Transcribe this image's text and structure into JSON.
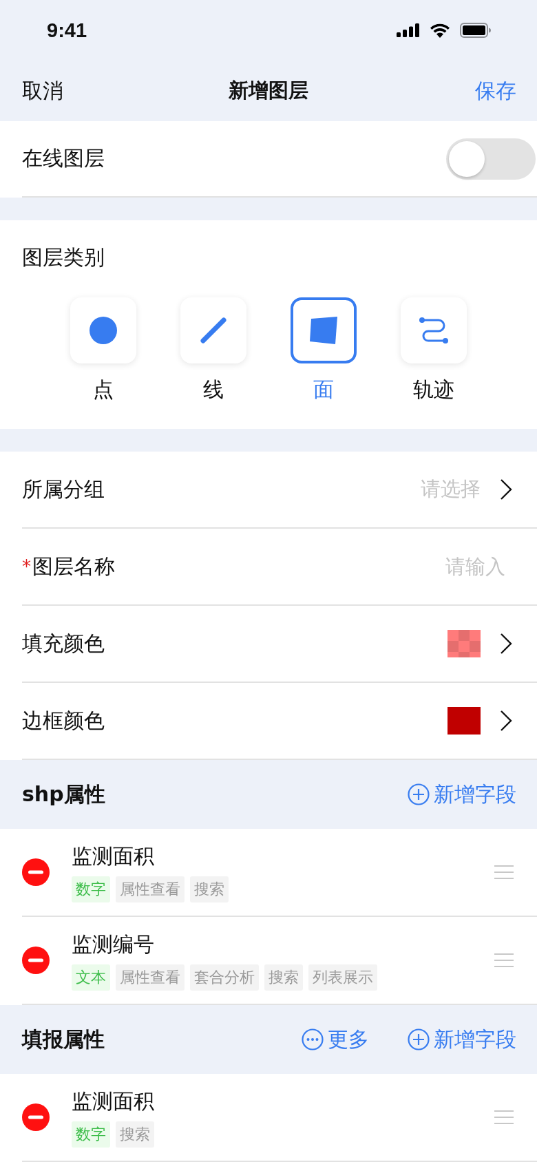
{
  "status_bar": {
    "time": "9:41"
  },
  "nav": {
    "cancel": "取消",
    "title": "新增图层",
    "save": "保存"
  },
  "online_layer": {
    "label": "在线图层",
    "on": false
  },
  "layer_type": {
    "label": "图层类别",
    "options": [
      {
        "kind": "point",
        "label": "点",
        "selected": false
      },
      {
        "kind": "line",
        "label": "线",
        "selected": false
      },
      {
        "kind": "polygon",
        "label": "面",
        "selected": true
      },
      {
        "kind": "track",
        "label": "轨迹",
        "selected": false
      }
    ]
  },
  "form_rows": [
    {
      "kind": "select",
      "label": "所属分组",
      "placeholder": "请选择"
    },
    {
      "kind": "input",
      "required_mark": "*",
      "label": "图层名称",
      "placeholder": "请输入"
    },
    {
      "kind": "color",
      "label": "填充颜色",
      "color": "#ff7b7b",
      "translucent": true
    },
    {
      "kind": "color",
      "label": "边框颜色",
      "color": "#c00000",
      "translucent": false
    }
  ],
  "shp_section": {
    "title": "shp属性",
    "actions": [
      {
        "kind": "add",
        "label": "新增字段"
      }
    ],
    "fields": [
      {
        "name": "监测面积",
        "tags": [
          {
            "kind": "type",
            "label": "数字"
          },
          {
            "kind": "option",
            "label": "属性查看"
          },
          {
            "kind": "option",
            "label": "搜索"
          }
        ]
      },
      {
        "name": "监测编号",
        "tags": [
          {
            "kind": "type",
            "label": "文本"
          },
          {
            "kind": "option",
            "label": "属性查看"
          },
          {
            "kind": "option",
            "label": "套合分析"
          },
          {
            "kind": "option",
            "label": "搜索"
          },
          {
            "kind": "option",
            "label": "列表展示"
          }
        ]
      }
    ]
  },
  "report_section": {
    "title": "填报属性",
    "actions": [
      {
        "kind": "more",
        "label": "更多"
      },
      {
        "kind": "add",
        "label": "新增字段"
      }
    ],
    "fields": [
      {
        "name": "监测面积",
        "tags": [
          {
            "kind": "type",
            "label": "数字"
          },
          {
            "kind": "option",
            "label": "搜索"
          }
        ]
      }
    ]
  }
}
